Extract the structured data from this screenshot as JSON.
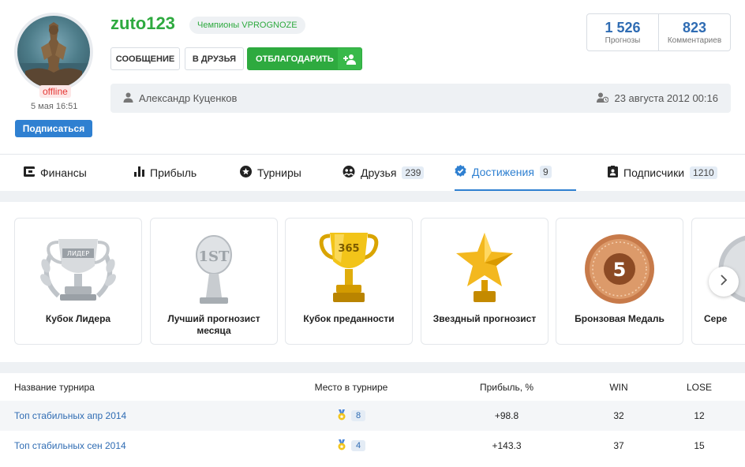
{
  "profile": {
    "username": "zuto123",
    "champion_badge": "Чемпионы VPROGNOZE",
    "status": "offline",
    "last_seen": "5 мая 16:51",
    "subscribe_label": "Подписаться",
    "full_name": "Александр Куценков",
    "registered": "23 августа 2012 00:16"
  },
  "actions": {
    "message": "СООБЩЕНИЕ",
    "add_friend": "В ДРУЗЬЯ",
    "thank": "ОТБЛАГОДАРИТЬ"
  },
  "stats": {
    "predictions_count": "1 526",
    "predictions_label": "Прогнозы",
    "comments_count": "823",
    "comments_label": "Комментариев"
  },
  "tabs": [
    {
      "label": "Финансы",
      "icon": "wallet-icon",
      "count": ""
    },
    {
      "label": "Прибыль",
      "icon": "bar-chart-icon",
      "count": ""
    },
    {
      "label": "Турниры",
      "icon": "star-circle-icon",
      "count": ""
    },
    {
      "label": "Друзья",
      "icon": "friends-icon",
      "count": "239"
    },
    {
      "label": "Достижения",
      "icon": "verified-badge-icon",
      "count": "9",
      "active": true
    },
    {
      "label": "Подписчики",
      "icon": "id-card-icon",
      "count": "1210"
    }
  ],
  "achievements": [
    {
      "name": "Кубок Лидера",
      "icon": "silver-leader-cup-icon",
      "cup_text": "ЛИДЕР"
    },
    {
      "name": "Лучший прогнозист месяца",
      "icon": "first-place-trophy-icon",
      "cup_text": "1ST"
    },
    {
      "name": "Кубок преданности",
      "icon": "gold-365-cup-icon",
      "cup_text": "365"
    },
    {
      "name": "Звездный прогнозист",
      "icon": "gold-star-trophy-icon"
    },
    {
      "name": "Бронзовая Медаль",
      "icon": "bronze-medal-icon",
      "cup_text": "5"
    },
    {
      "name": "Сере",
      "icon": "silver-medal-icon"
    }
  ],
  "tournaments": {
    "headers": {
      "name": "Название турнира",
      "place": "Место в турнире",
      "profit": "Прибыль, %",
      "win": "WIN",
      "lose": "LOSE"
    },
    "rows": [
      {
        "name": "Топ стабильных апр 2014",
        "place": "8",
        "profit": "+98.8",
        "win": "32",
        "lose": "12"
      },
      {
        "name": "Топ стабильных сен 2014",
        "place": "4",
        "profit": "+143.3",
        "win": "37",
        "lose": "15"
      }
    ]
  },
  "colors": {
    "green": "#2eaa3f",
    "blue": "#2f80d1",
    "offline_red": "#e53935"
  }
}
